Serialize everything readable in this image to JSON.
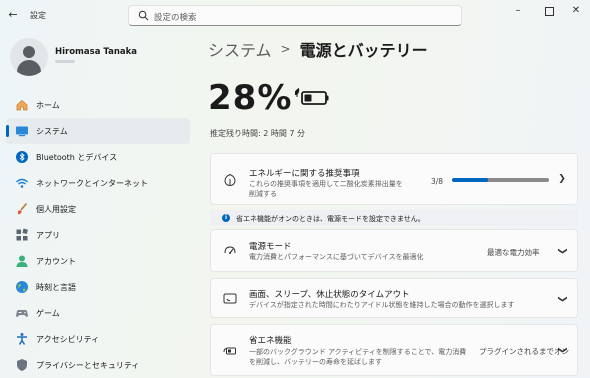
{
  "window": {
    "app_title": "設定",
    "search_placeholder": "設定の検索"
  },
  "profile": {
    "name": "Hiromasa Tanaka"
  },
  "sidebar": {
    "items": [
      {
        "label": "ホーム",
        "icon": "home-icon",
        "active": false
      },
      {
        "label": "システム",
        "icon": "system-icon",
        "active": true
      },
      {
        "label": "Bluetooth とデバイス",
        "icon": "bluetooth-icon",
        "active": false
      },
      {
        "label": "ネットワークとインターネット",
        "icon": "wifi-icon",
        "active": false
      },
      {
        "label": "個人用設定",
        "icon": "brush-icon",
        "active": false
      },
      {
        "label": "アプリ",
        "icon": "apps-icon",
        "active": false
      },
      {
        "label": "アカウント",
        "icon": "account-icon",
        "active": false
      },
      {
        "label": "時刻と言語",
        "icon": "globe-icon",
        "active": false
      },
      {
        "label": "ゲーム",
        "icon": "gamepad-icon",
        "active": false
      },
      {
        "label": "アクセシビリティ",
        "icon": "accessibility-icon",
        "active": false
      },
      {
        "label": "プライバシーとセキュリティ",
        "icon": "shield-icon",
        "active": false
      }
    ]
  },
  "breadcrumb": {
    "parent": "システム",
    "separator": ">",
    "current": "電源とバッテリー"
  },
  "battery": {
    "percent": "28%",
    "remaining": "推定残り時間: 2 時間 7 分"
  },
  "cards": {
    "energy": {
      "title": "エネルギーに関する推奨事項",
      "desc": "これらの推奨事項を適用して二酸化炭素排出量を削減する",
      "count": "3/8",
      "progress_fraction": 0.375
    },
    "info": {
      "text": "省エネ機能がオンのときは、電源モードを設定できません。"
    },
    "power_mode": {
      "title": "電源モード",
      "desc": "電力消費とパフォーマンスに基づいてデバイスを最適化",
      "value": "最適な電力効率"
    },
    "screen": {
      "title": "画面、スリープ、休止状態のタイムアウト",
      "desc": "デバイスが指定された時間にわたりアイドル状態を維持した場合の動作を選択します"
    },
    "energy_saver": {
      "title": "省エネ機能",
      "desc": "一部のバックグラウンド アクティビティを制限することで、電力消費を削減し、バッテリーの寿命を延ばします",
      "value": "プラグインされるまでオン"
    }
  },
  "colors": {
    "accent": "#0067c0",
    "battery_fill": "#1b1b1b"
  }
}
